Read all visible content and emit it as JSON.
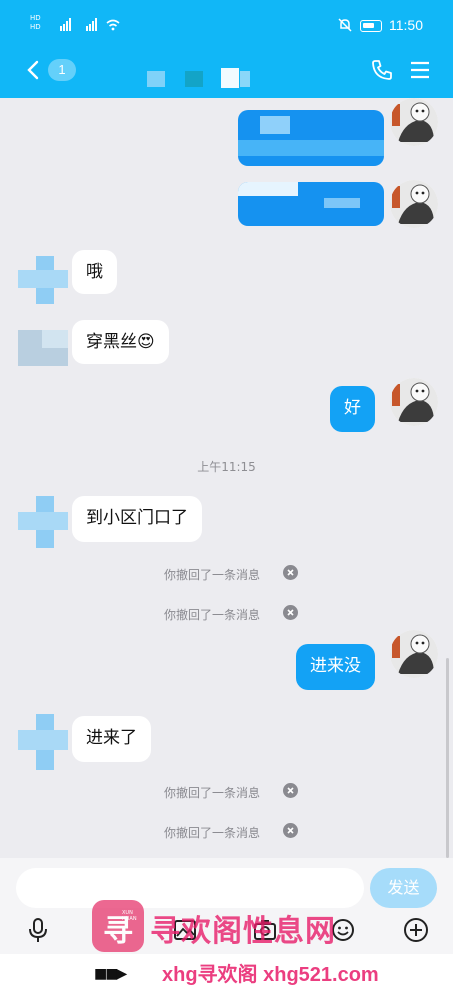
{
  "status_bar": {
    "network_1": "HD",
    "network_2": "HD",
    "signal_1": "5G",
    "signal_2": "4G",
    "time": "11:50"
  },
  "header": {
    "unread_count": "1",
    "accent_color": "#11b7f7"
  },
  "messages": [
    {
      "side": "in",
      "text": "哦"
    },
    {
      "side": "in",
      "text": "穿黑丝😍"
    },
    {
      "side": "out",
      "text": "好"
    },
    {
      "side": "in",
      "text": "到小区门口了"
    },
    {
      "side": "out",
      "text": "进来没"
    },
    {
      "side": "in",
      "text": "进来了"
    }
  ],
  "timestamp": "上午11:15",
  "recall_notice": "你撤回了一条消息",
  "input": {
    "placeholder": "",
    "send_label": "发送"
  },
  "watermark": {
    "logo_char": "寻",
    "logo_small": "XUN HUAN",
    "title": "寻欢阁性息网",
    "url": "xhg寻欢阁 xhg521.com",
    "arrows": "■■▶"
  },
  "toolbar_icons": [
    "microphone-icon",
    "image-icon",
    "camera-icon",
    "emoji-icon",
    "plus-icon"
  ],
  "colors": {
    "bubble_out": "#13a2f5",
    "bubble_in": "#ffffff",
    "send_button": "#a6dcfa",
    "watermark": "#e81d6a"
  }
}
